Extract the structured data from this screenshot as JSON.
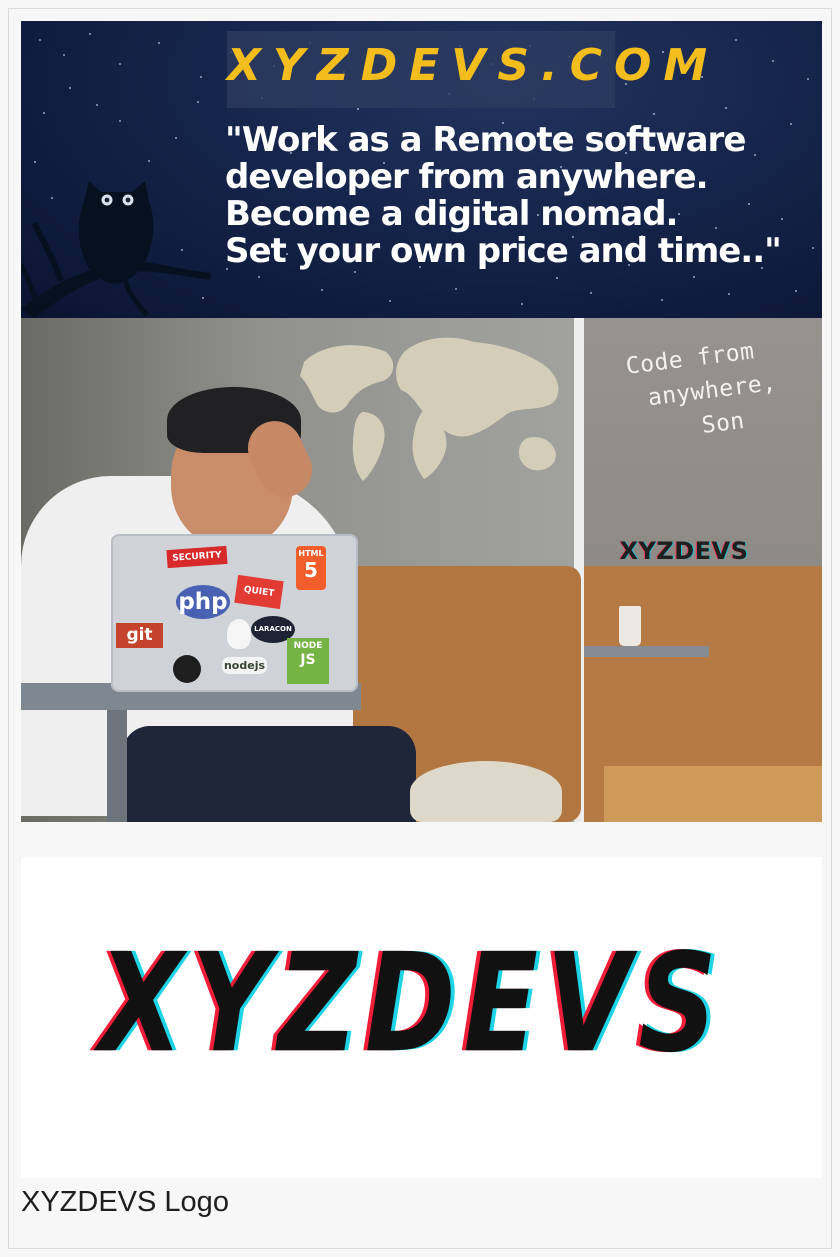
{
  "banner": {
    "site_name": "XYZDEVS.COM",
    "quote_lines": [
      "\"Work as a Remote software",
      "developer from anywhere.",
      "Become a digital nomad.",
      "Set your own price and time..\""
    ],
    "wall_note_lines": [
      "Code from",
      "anywhere,",
      "Son"
    ],
    "wall_brand": "XYZDEVS"
  },
  "stickers": {
    "security": "SECURITY",
    "html": "HTML",
    "five": "5",
    "quiet": "QUIET",
    "php": "php",
    "git": "git",
    "laracon": "LARACON",
    "node": "NODE",
    "js": "JS",
    "nodejs": "nodejs"
  },
  "logo": {
    "text": "XYZDEVS",
    "caption": "XYZDEVS Logo"
  },
  "colors": {
    "brand_yellow": "#f2bd1d",
    "logo_red": "#ef1d37",
    "logo_cyan": "#1ed3e6"
  }
}
